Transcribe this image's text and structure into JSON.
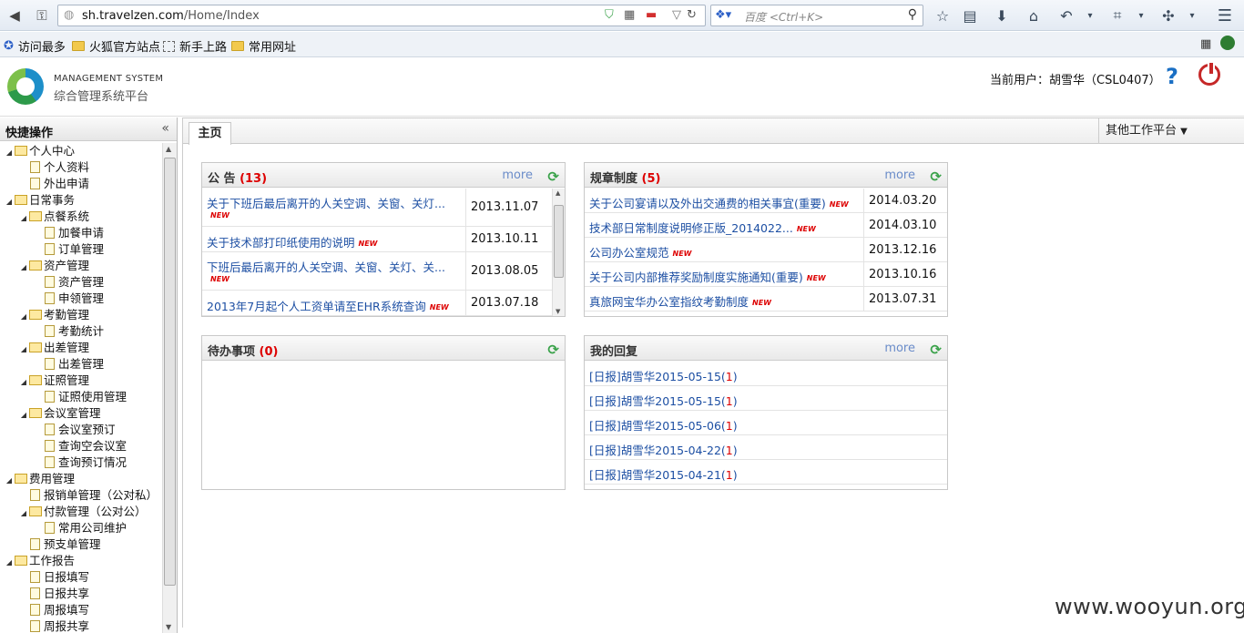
{
  "browser": {
    "url_host": "sh.travelzen.com",
    "url_path": "/Home/Index",
    "search_placeholder": "百度 <Ctrl+K>",
    "bookmarks": [
      "访问最多",
      "火狐官方站点",
      "新手上路",
      "常用网址"
    ]
  },
  "header": {
    "system_en": "MANAGEMENT SYSTEM",
    "system_cn": "综合管理系统平台",
    "current_user": "当前用户：胡雪华（CSL0407）"
  },
  "sidebar": {
    "title": "快捷操作",
    "tree": [
      {
        "level": 0,
        "type": "folder",
        "label": "个人中心"
      },
      {
        "level": 1,
        "type": "doc",
        "label": "个人资料"
      },
      {
        "level": 1,
        "type": "doc",
        "label": "外出申请"
      },
      {
        "level": 0,
        "type": "folder",
        "label": "日常事务"
      },
      {
        "level": 1,
        "type": "folder",
        "label": "点餐系统"
      },
      {
        "level": 2,
        "type": "doc",
        "label": "加餐申请"
      },
      {
        "level": 2,
        "type": "doc",
        "label": "订单管理"
      },
      {
        "level": 1,
        "type": "folder",
        "label": "资产管理"
      },
      {
        "level": 2,
        "type": "doc",
        "label": "资产管理"
      },
      {
        "level": 2,
        "type": "doc",
        "label": "申领管理"
      },
      {
        "level": 1,
        "type": "folder",
        "label": "考勤管理"
      },
      {
        "level": 2,
        "type": "doc",
        "label": "考勤统计"
      },
      {
        "level": 1,
        "type": "folder",
        "label": "出差管理"
      },
      {
        "level": 2,
        "type": "doc",
        "label": "出差管理"
      },
      {
        "level": 1,
        "type": "folder",
        "label": "证照管理"
      },
      {
        "level": 2,
        "type": "doc",
        "label": "证照使用管理"
      },
      {
        "level": 1,
        "type": "folder",
        "label": "会议室管理"
      },
      {
        "level": 2,
        "type": "doc",
        "label": "会议室预订"
      },
      {
        "level": 2,
        "type": "doc",
        "label": "查询空会议室"
      },
      {
        "level": 2,
        "type": "doc",
        "label": "查询预订情况"
      },
      {
        "level": 0,
        "type": "folder",
        "label": "费用管理"
      },
      {
        "level": 1,
        "type": "doc",
        "label": "报销单管理（公对私）"
      },
      {
        "level": 1,
        "type": "folder",
        "label": "付款管理（公对公）"
      },
      {
        "level": 2,
        "type": "doc",
        "label": "常用公司维护"
      },
      {
        "level": 1,
        "type": "doc",
        "label": "预支单管理"
      },
      {
        "level": 0,
        "type": "folder",
        "label": "工作报告"
      },
      {
        "level": 1,
        "type": "doc",
        "label": "日报填写"
      },
      {
        "level": 1,
        "type": "doc",
        "label": "日报共享"
      },
      {
        "level": 1,
        "type": "doc",
        "label": "周报填写"
      },
      {
        "level": 1,
        "type": "doc",
        "label": "周报共享"
      }
    ]
  },
  "tabs": {
    "home": "主页",
    "other_platform": "其他工作平台"
  },
  "panels": {
    "notice": {
      "title": "公 告",
      "count": "(13)",
      "more": "more",
      "rows": [
        {
          "title": "关于下班后最后离开的人关空调、关窗、关灯...",
          "date": "2013.11.07",
          "new": true,
          "wrap": true
        },
        {
          "title": "关于技术部打印纸使用的说明",
          "date": "2013.10.11",
          "new": true,
          "wrap": false
        },
        {
          "title": "下班后最后离开的人关空调、关窗、关灯、关...",
          "date": "2013.08.05",
          "new": true,
          "wrap": true
        },
        {
          "title": "2013年7月起个人工资单请至EHR系统查询",
          "date": "2013.07.18",
          "new": true,
          "wrap": false
        }
      ]
    },
    "rules": {
      "title": "规章制度",
      "count": "(5)",
      "more": "more",
      "rows": [
        {
          "title": "关于公司宴请以及外出交通费的相关事宜(重要)",
          "date": "2014.03.20",
          "new": true
        },
        {
          "title": "技术部日常制度说明修正版_2014022...",
          "date": "2014.03.10",
          "new": true
        },
        {
          "title": "公司办公室规范",
          "date": "2013.12.16",
          "new": true
        },
        {
          "title": "关于公司内部推荐奖励制度实施通知(重要)",
          "date": "2013.10.16",
          "new": true
        },
        {
          "title": "真旅网宝华办公室指纹考勤制度",
          "date": "2013.07.31",
          "new": true
        }
      ]
    },
    "todo": {
      "title": "待办事项",
      "count": "(0)"
    },
    "replies": {
      "title": "我的回复",
      "more": "more",
      "rows": [
        {
          "title": "[日报]胡雪华2015-05-15",
          "count": "1"
        },
        {
          "title": "[日报]胡雪华2015-05-15",
          "count": "1"
        },
        {
          "title": "[日报]胡雪华2015-05-06",
          "count": "1"
        },
        {
          "title": "[日报]胡雪华2015-04-22",
          "count": "1"
        },
        {
          "title": "[日报]胡雪华2015-04-21",
          "count": "1"
        }
      ]
    }
  },
  "new_badge": "NEW",
  "watermark": "www.wooyun.org"
}
